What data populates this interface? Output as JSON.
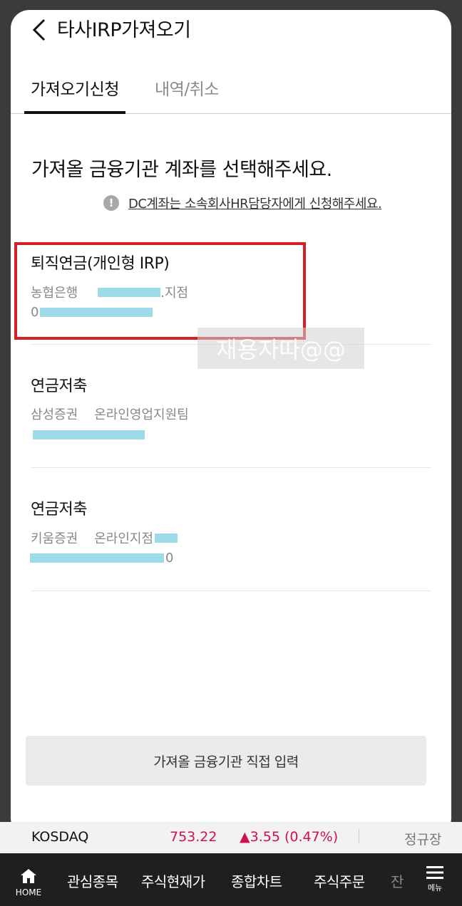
{
  "header": {
    "title": "타사IRP가져오기"
  },
  "tabs": [
    {
      "label": "가져오기신청",
      "active": true
    },
    {
      "label": "내역/취소",
      "active": false
    }
  ],
  "main": {
    "headline": "가져올 금융기관 계좌를 선택해주세요.",
    "notice": "DC계좌는 소속회사HR담당자에게 신청해주세요."
  },
  "accounts": [
    {
      "type": "퇴직연금(개인형 IRP)",
      "bank": "농협은행",
      "branch": ".지점",
      "number_prefix": "0"
    },
    {
      "type": "연금저축",
      "bank": "삼성증권",
      "branch": "온라인영업지원팀"
    },
    {
      "type": "연금저축",
      "bank": "키움증권",
      "branch": "온라인지점",
      "number_suffix": "0"
    }
  ],
  "watermark": "재용자따@@",
  "direct_input_label": "가져올 금융기관 직접 입력",
  "ticker": {
    "name": "KOSDAQ",
    "value": "753.22",
    "change": "▲3.55 (0.47%)",
    "status": "정규장",
    "color": "#d0104c"
  },
  "bottom_nav": {
    "home_label": "HOME",
    "items": [
      "관심종목",
      "주식현재가",
      "종합차트",
      "주식주문",
      "잔"
    ],
    "menu_label": "메뉴"
  }
}
